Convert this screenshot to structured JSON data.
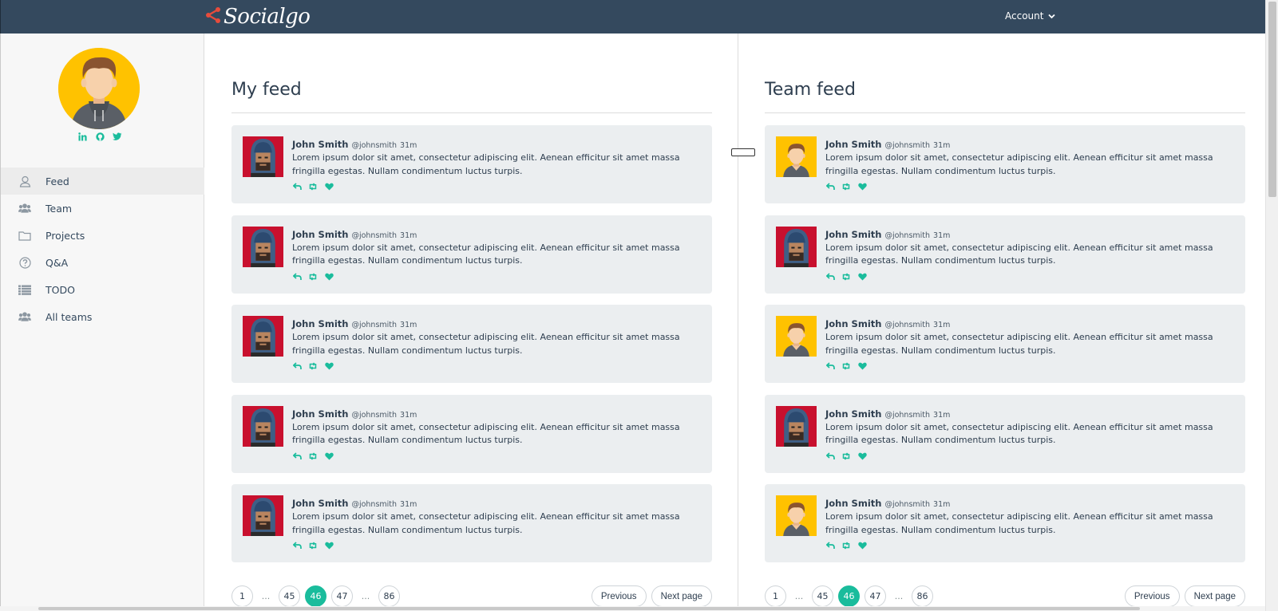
{
  "header": {
    "logo_text": "Socialgo",
    "account_label": "Account"
  },
  "colors": {
    "topbar": "#34495e",
    "accent": "#1abc9c",
    "logo_icon": "#e74c3c",
    "post_bg": "#ebeef0"
  },
  "sidebar": {
    "socials": [
      "linkedin-icon",
      "github-icon",
      "twitter-icon"
    ],
    "items": [
      {
        "label": "Feed",
        "icon": "user-icon",
        "active": true
      },
      {
        "label": "Team",
        "icon": "users-icon"
      },
      {
        "label": "Projects",
        "icon": "folder-icon"
      },
      {
        "label": "Q&A",
        "icon": "question-icon"
      },
      {
        "label": "TODO",
        "icon": "list-icon"
      },
      {
        "label": "All teams",
        "icon": "users-icon"
      }
    ]
  },
  "my_feed": {
    "title": "My feed",
    "posts": [
      {
        "name": "John Smith",
        "handle": "@johnsmith",
        "time": "31m",
        "text": "Lorem ipsum dolor sit amet, consectetur adipiscing elit. Aenean efficitur sit amet massa fringilla egestas. Nullam condimentum luctus turpis.",
        "avatar": "hooded-avatar"
      },
      {
        "name": "John Smith",
        "handle": "@johnsmith",
        "time": "31m",
        "text": "Lorem ipsum dolor sit amet, consectetur adipiscing elit. Aenean efficitur sit amet massa fringilla egestas. Nullam condimentum luctus turpis.",
        "avatar": "hooded-avatar"
      },
      {
        "name": "John Smith",
        "handle": "@johnsmith",
        "time": "31m",
        "text": "Lorem ipsum dolor sit amet, consectetur adipiscing elit. Aenean efficitur sit amet massa fringilla egestas. Nullam condimentum luctus turpis.",
        "avatar": "hooded-avatar"
      },
      {
        "name": "John Smith",
        "handle": "@johnsmith",
        "time": "31m",
        "text": "Lorem ipsum dolor sit amet, consectetur adipiscing elit. Aenean efficitur sit amet massa fringilla egestas. Nullam condimentum luctus turpis.",
        "avatar": "hooded-avatar"
      },
      {
        "name": "John Smith",
        "handle": "@johnsmith",
        "time": "31m",
        "text": "Lorem ipsum dolor sit amet, consectetur adipiscing elit. Aenean efficitur sit amet massa fringilla egestas. Nullam condimentum luctus turpis.",
        "avatar": "hooded-avatar"
      }
    ],
    "pagination": {
      "pages": [
        "1",
        "...",
        "45",
        "46",
        "47",
        "...",
        "86"
      ],
      "active": "46",
      "previous": "Previous",
      "next": "Next page"
    }
  },
  "team_feed": {
    "title": "Team feed",
    "posts": [
      {
        "name": "John Smith",
        "handle": "@johnsmith",
        "time": "31m",
        "text": "Lorem ipsum dolor sit amet, consectetur adipiscing elit. Aenean efficitur sit amet massa fringilla egestas. Nullam condimentum luctus turpis.",
        "avatar": "man-avatar"
      },
      {
        "name": "John Smith",
        "handle": "@johnsmith",
        "time": "31m",
        "text": "Lorem ipsum dolor sit amet, consectetur adipiscing elit. Aenean efficitur sit amet massa fringilla egestas. Nullam condimentum luctus turpis.",
        "avatar": "hooded-avatar"
      },
      {
        "name": "John Smith",
        "handle": "@johnsmith",
        "time": "31m",
        "text": "Lorem ipsum dolor sit amet, consectetur adipiscing elit. Aenean efficitur sit amet massa fringilla egestas. Nullam condimentum luctus turpis.",
        "avatar": "man-avatar"
      },
      {
        "name": "John Smith",
        "handle": "@johnsmith",
        "time": "31m",
        "text": "Lorem ipsum dolor sit amet, consectetur adipiscing elit. Aenean efficitur sit amet massa fringilla egestas. Nullam condimentum luctus turpis.",
        "avatar": "hooded-avatar"
      },
      {
        "name": "John Smith",
        "handle": "@johnsmith",
        "time": "31m",
        "text": "Lorem ipsum dolor sit amet, consectetur adipiscing elit. Aenean efficitur sit amet massa fringilla egestas. Nullam condimentum luctus turpis.",
        "avatar": "man-avatar"
      }
    ],
    "pagination": {
      "pages": [
        "1",
        "...",
        "45",
        "46",
        "47",
        "...",
        "86"
      ],
      "active": "46",
      "previous": "Previous",
      "next": "Next page"
    }
  }
}
